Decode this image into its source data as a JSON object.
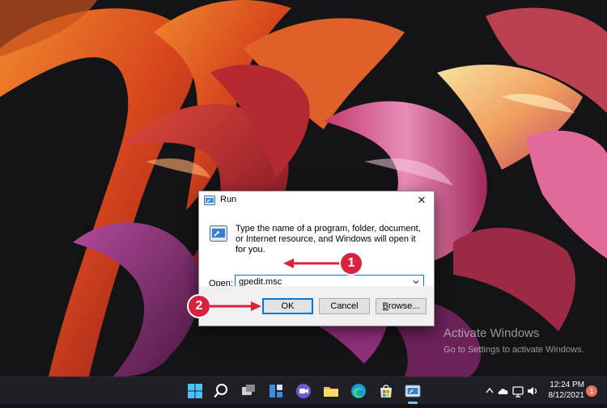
{
  "dialog": {
    "title": "Run",
    "description": "Type the name of a program, folder, document, or Internet resource, and Windows will open it for you.",
    "open_label_prefix": "",
    "open_label_accel": "O",
    "open_label_rest": "pen:",
    "open_value": "gpedit.msc",
    "ok_label": "OK",
    "cancel_label": "Cancel",
    "browse_accel": "B",
    "browse_rest": "rowse...",
    "close_glyph": "✕"
  },
  "annotations": {
    "step1": "1",
    "step2": "2",
    "color": "#d9233d"
  },
  "watermark": {
    "title": "Activate Windows",
    "subtitle": "Go to Settings to activate Windows."
  },
  "taskbar": {
    "apps": [
      "start-icon",
      "search-icon",
      "task-view-icon",
      "widgets-icon",
      "chat-icon",
      "file-explorer-icon",
      "edge-icon",
      "store-icon",
      "run-app-icon"
    ],
    "tray_chevron": "^",
    "time": "12:24 PM",
    "date": "8/12/2021",
    "notification_count": "1",
    "accent": "#60cdff"
  }
}
